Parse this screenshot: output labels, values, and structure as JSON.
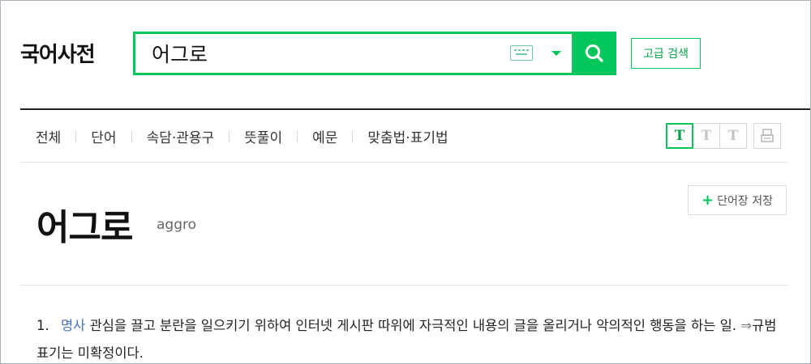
{
  "header": {
    "logo": "국어사전",
    "search": {
      "value": "어그로",
      "placeholder": ""
    },
    "advanced_search_label": "고급 검색"
  },
  "tabs": [
    {
      "label": "전체"
    },
    {
      "label": "단어"
    },
    {
      "label": "속담·관용구"
    },
    {
      "label": "뜻풀이"
    },
    {
      "label": "예문"
    },
    {
      "label": "맞춤법·표기법"
    }
  ],
  "font_tools": {
    "font_size_letter": "T"
  },
  "entry": {
    "headword": "어그로",
    "origin": "aggro",
    "save_label": "단어장 저장",
    "save_plus": "+",
    "senses": [
      {
        "number": "1.",
        "pos": "명사",
        "definition": "관심을 끌고 분란을 일으키기 위하여 인터넷 게시판 따위에 자극적인 내용의 글을 올리거나 악의적인 행동을 하는 일.",
        "note_arrow": "⇒",
        "note": "규범 표기는 미확정이다."
      }
    ]
  },
  "colors": {
    "accent": "#03c75a",
    "pos_link": "#4a73b3"
  },
  "icons": [
    "keyboard-icon",
    "chevron-down-icon",
    "search-icon",
    "print-icon"
  ]
}
